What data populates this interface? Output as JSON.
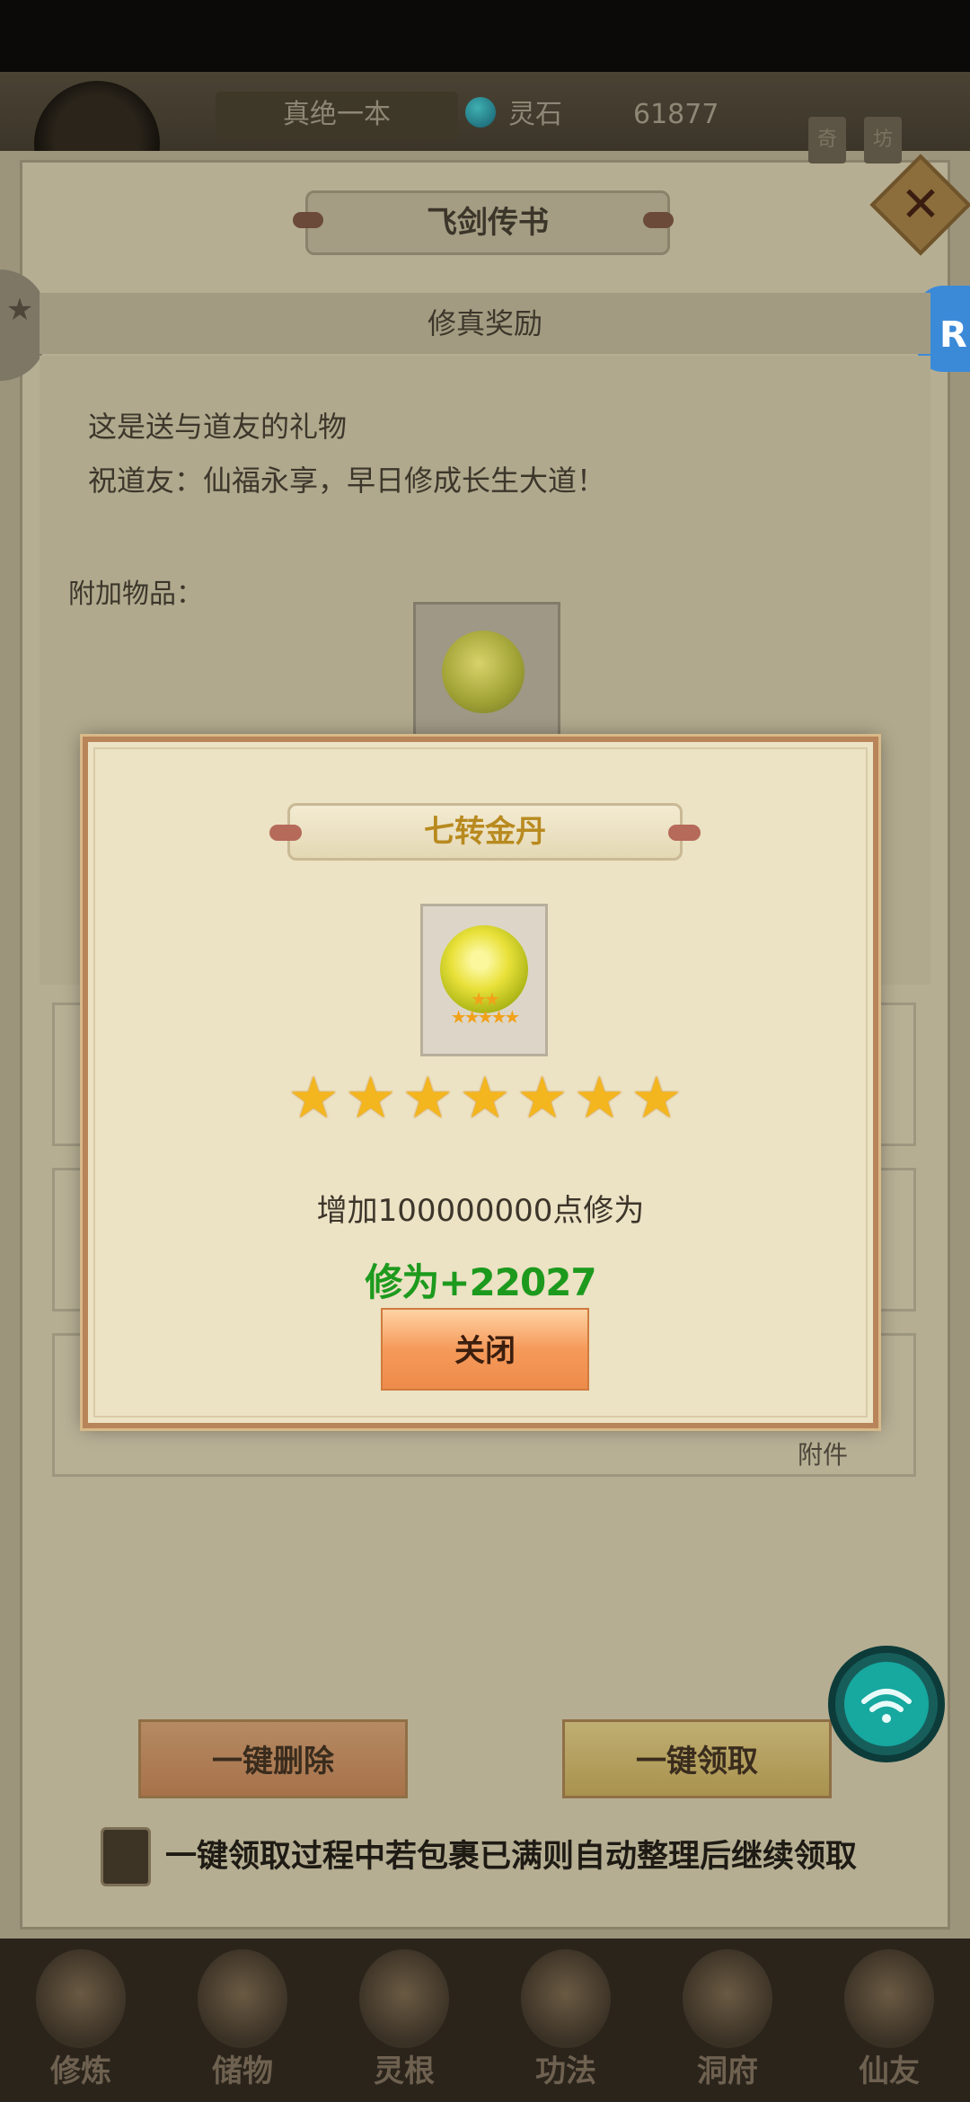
{
  "hud": {
    "player_name": "真绝一本",
    "currency_label": "灵石",
    "currency_value": "61877",
    "right_buttons": [
      "奇",
      "坊"
    ]
  },
  "mail": {
    "window_title": "飞剑传书",
    "subject": "修真奖励",
    "body_lines": [
      "这是送与道友的礼物",
      "祝道友：仙福永享，早日修成长生大道！"
    ],
    "attachments_label": "附加物品：",
    "attach_tag": "附件",
    "delete_all_label": "一键删除",
    "claim_all_label": "一键领取",
    "auto_sort_text": "一键领取过程中若包裹已满则自动整理后继续领取"
  },
  "side_pet": {
    "letter": "R"
  },
  "nav": {
    "items": [
      {
        "label": "修炼",
        "icon": "cultivate-icon"
      },
      {
        "label": "储物",
        "icon": "bag-icon"
      },
      {
        "label": "灵根",
        "icon": "spirit-root-icon"
      },
      {
        "label": "功法",
        "icon": "technique-icon"
      },
      {
        "label": "洞府",
        "icon": "cave-icon"
      },
      {
        "label": "仙友",
        "icon": "friends-icon"
      }
    ]
  },
  "reward_modal": {
    "item_name": "七转金丹",
    "item_stars": 7,
    "description": "增加100000000点修为",
    "gain_text": "修为+22027",
    "close_label": "关闭"
  },
  "colors": {
    "modal_bg": "#ece2c4",
    "title_gold": "#b88a1f",
    "gain_green": "#1d9a1d",
    "star_gold": "#f4b61e",
    "close_btn": "#f59a5a"
  }
}
